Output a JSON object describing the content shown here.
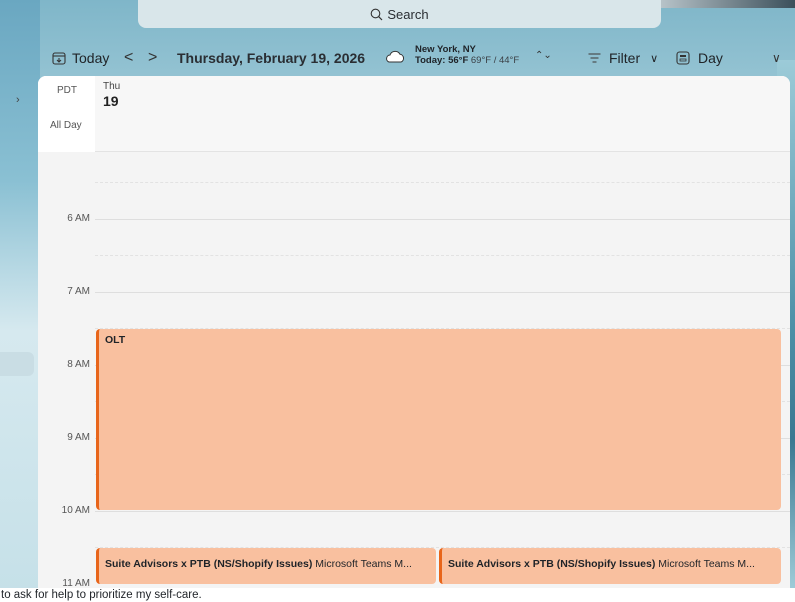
{
  "search": {
    "placeholder": "Search",
    "icon": "search-icon"
  },
  "toolbar": {
    "today_label": "Today",
    "prev_label": "<",
    "next_label": ">",
    "date_label": "Thursday, February 19, 2026",
    "weather": {
      "city": "New York, NY",
      "today_prefix": "Today: 56°F",
      "hilo": "69°F / 44°F",
      "icon": "cloud-icon"
    },
    "filter_label": "Filter",
    "view_label": "Day"
  },
  "calendar": {
    "timezone": "PDT",
    "all_day_label": "All Day",
    "day_of_week": "Thu",
    "day_number": "19",
    "hours": [
      "6 AM",
      "7 AM",
      "8 AM",
      "9 AM",
      "10 AM",
      "11 AM"
    ],
    "events": [
      {
        "title": "OLT",
        "description": ""
      },
      {
        "title": "Suite Advisors x PTB (NS/Shopify Issues)",
        "description": "Microsoft Teams M..."
      },
      {
        "title": "Suite Advisors x PTB (NS/Shopify Issues)",
        "description": "Microsoft Teams M..."
      }
    ],
    "event_color": "#f9c09f",
    "event_accent": "#e8651a"
  },
  "footer": {
    "text": "to ask for help to prioritize my self-care."
  }
}
